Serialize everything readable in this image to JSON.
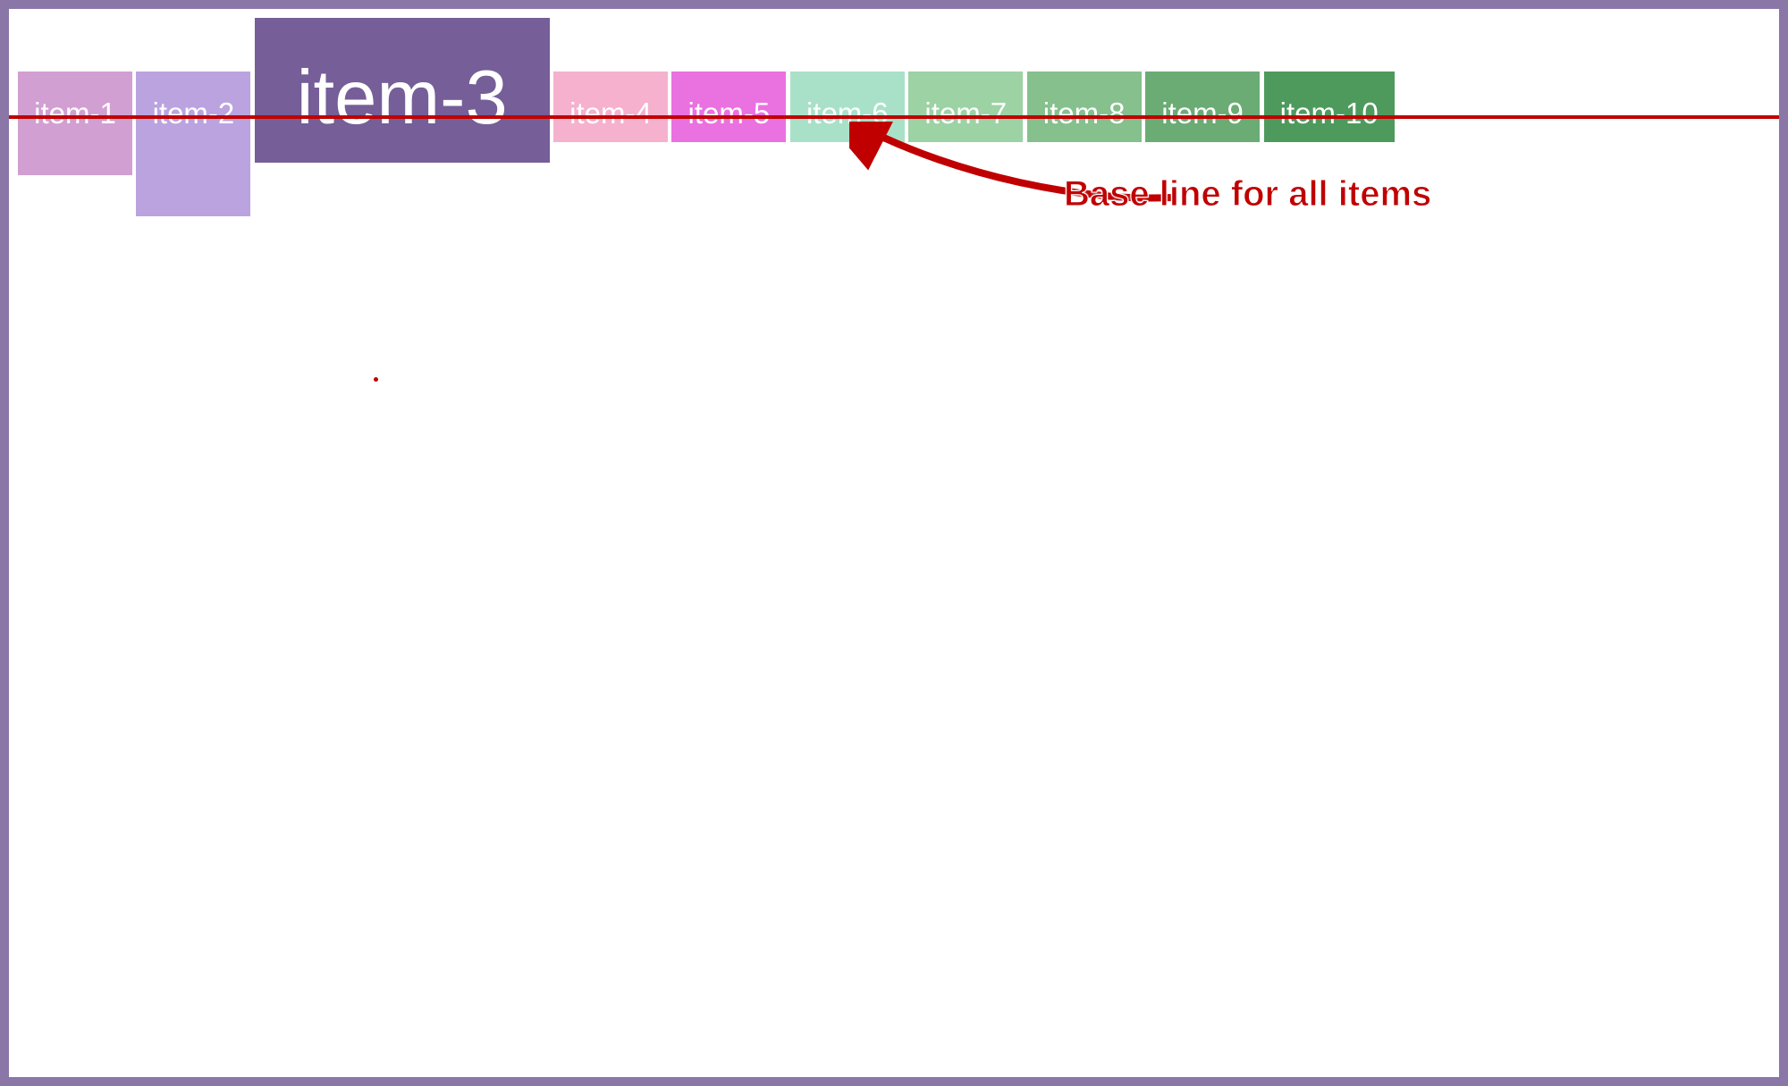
{
  "items": [
    {
      "label": "item-1",
      "class": "item-1"
    },
    {
      "label": "item-2",
      "class": "item-2"
    },
    {
      "label": "item-3",
      "class": "item-3"
    },
    {
      "label": "item-4",
      "class": "item-4"
    },
    {
      "label": "item-5",
      "class": "item-5"
    },
    {
      "label": "item-6",
      "class": "item-6"
    },
    {
      "label": "item-7",
      "class": "item-7"
    },
    {
      "label": "item-8",
      "class": "item-8"
    },
    {
      "label": "item-9",
      "class": "item-9"
    },
    {
      "label": "item-10",
      "class": "item-10"
    }
  ],
  "annotation": {
    "caption": "Base line for all items"
  },
  "colors": {
    "border": "#8a77a8",
    "accent": "#c00000"
  }
}
